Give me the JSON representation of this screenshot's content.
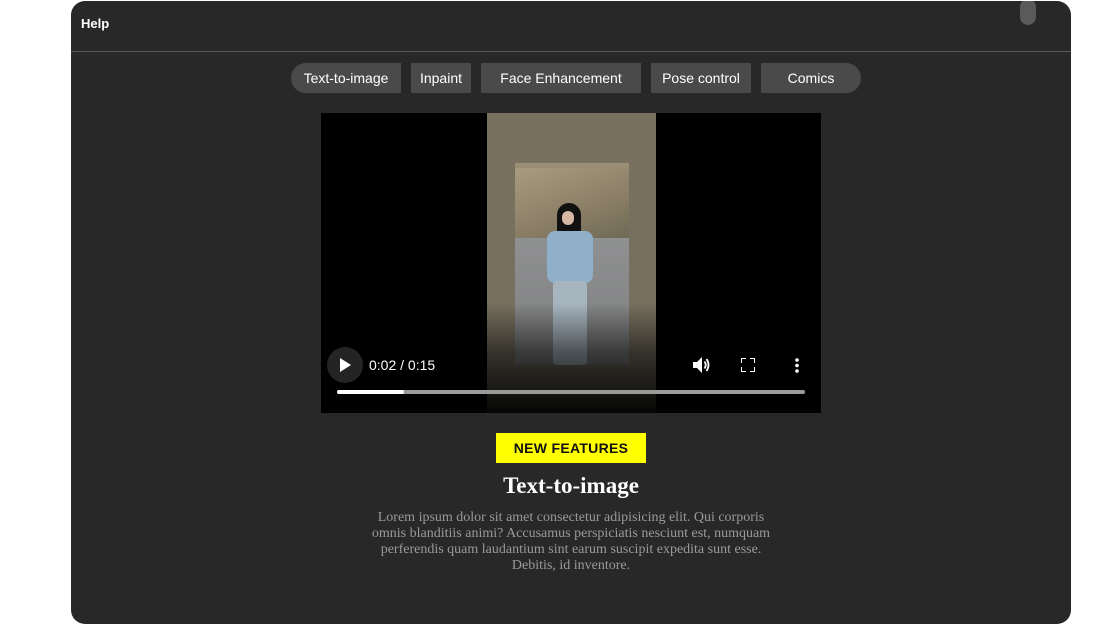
{
  "header": {
    "title": "Help"
  },
  "tabs": [
    {
      "label": "Text-to-image"
    },
    {
      "label": "Inpaint"
    },
    {
      "label": "Face Enhancement"
    },
    {
      "label": "Pose control"
    },
    {
      "label": "Comics"
    }
  ],
  "video": {
    "time_display": "0:02 / 0:15",
    "progress_fraction": 0.143,
    "play_icon": "play-icon",
    "volume_icon": "volume-icon",
    "fullscreen_icon": "fullscreen-icon",
    "more_icon": "more-vertical-icon"
  },
  "feature": {
    "badge": "NEW FEATURES",
    "title": "Text-to-image",
    "description": "Lorem ipsum dolor sit amet consectetur adipisicing elit. Qui corporis omnis blanditiis animi? Accusamus perspiciatis nesciunt est, numquam perferendis quam laudantium sint earum suscipit expedita sunt esse. Debitis, id inventore."
  },
  "colors": {
    "panel_bg": "#282828",
    "tab_bg": "#4a4a4a",
    "badge_bg": "#ffff00",
    "text_primary": "#ffffff",
    "text_muted": "#9a9a9a"
  }
}
